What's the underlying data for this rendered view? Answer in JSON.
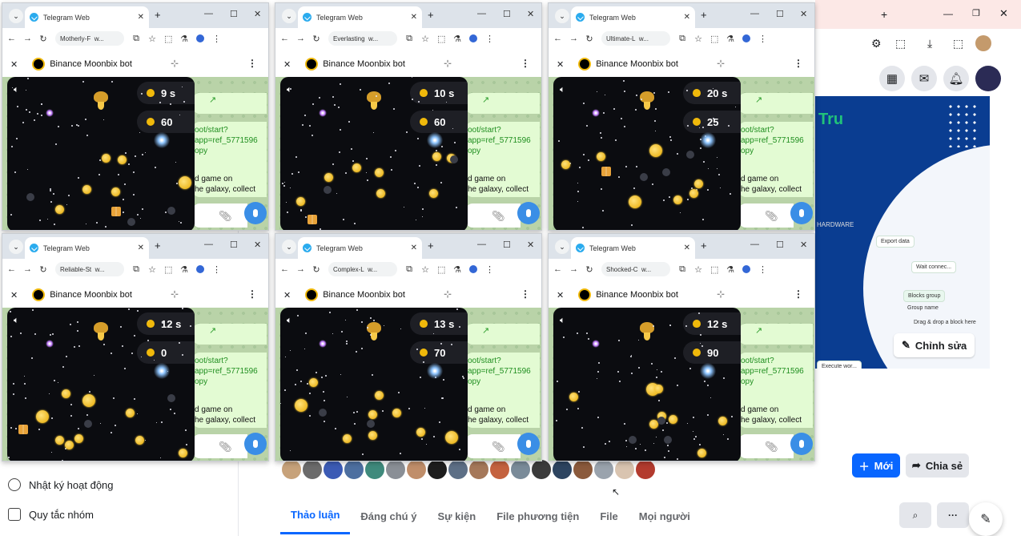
{
  "browser": {
    "tab_title": "Telegram Web",
    "bot_title": "Binance Moonbix bot"
  },
  "windows": [
    {
      "url": "Motherly-F",
      "time": "9 s",
      "score": "60"
    },
    {
      "url": "Everlasting",
      "time": "10 s",
      "score": "60"
    },
    {
      "url": "Ultimate-L",
      "time": "20 s",
      "score": "25"
    },
    {
      "url": "Reliable-St",
      "time": "12 s",
      "score": "0"
    },
    {
      "url": "Complex-L",
      "time": "13 s",
      "score": "70"
    },
    {
      "url": "Shocked-C",
      "time": "12 s",
      "score": "90"
    }
  ],
  "url_suffix": "w...",
  "chat": {
    "link_line1": "oot/start?",
    "link_line2": "app=ref_5771596",
    "link_line3": "opy",
    "text_line1": "d game on",
    "text_line2": "he galaxy, collect"
  },
  "sidebar": {
    "items": [
      {
        "label": "Nhật ký hoạt động",
        "icon": "clock-icon"
      },
      {
        "label": "Quy tắc nhóm",
        "icon": "rules-icon"
      }
    ]
  },
  "cover": {
    "text_brand": "Tru",
    "hardware": "HARDWARE",
    "flow": [
      "Export data",
      "Wait connec...",
      "Blocks group",
      "Group name",
      "Drag & drop a block here",
      "Execute wor..."
    ],
    "edit_label": "Chỉnh sửa"
  },
  "actions": {
    "new_label": "Mới",
    "share_label": "Chia sẻ"
  },
  "tabs": [
    "Thảo luận",
    "Đáng chú ý",
    "Sự kiện",
    "File phương tiện",
    "File",
    "Mọi người"
  ],
  "colors": {
    "accent": "#0866ff",
    "telegram": "#2aabee",
    "coin": "#f0b90b"
  }
}
